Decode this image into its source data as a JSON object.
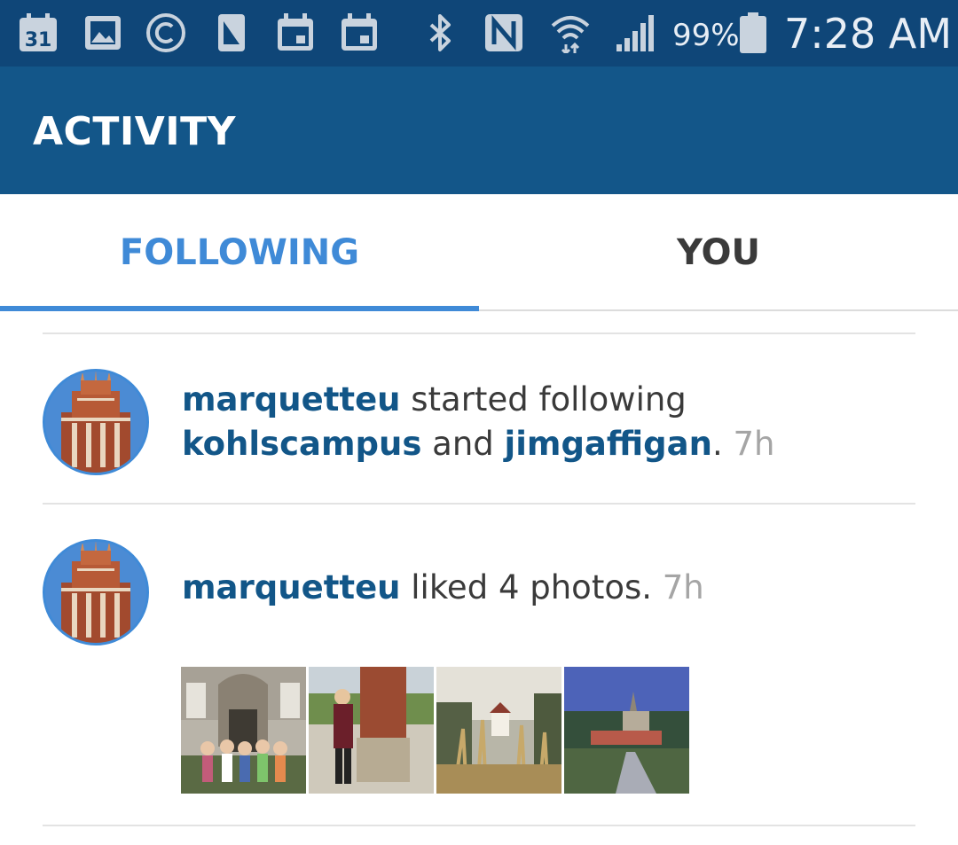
{
  "status_bar": {
    "icons": [
      "calendar-31-icon",
      "gallery-icon",
      "copyright-icon",
      "phone-icon",
      "calendar-event-icon",
      "calendar-event-icon",
      "bluetooth-icon",
      "nfc-icon",
      "wifi-icon",
      "signal-icon",
      "battery-icon"
    ],
    "calendar_day": "31",
    "battery_percent": "99%",
    "time": "7:28 AM"
  },
  "header": {
    "title": "ACTIVITY"
  },
  "tabs": [
    {
      "label": "FOLLOWING",
      "active": true
    },
    {
      "label": "YOU",
      "active": false
    }
  ],
  "feed": [
    {
      "user": "marquetteu",
      "action": " started following ",
      "target1": "kohlscampus",
      "connector": " and ",
      "target2": "jimgaffigan",
      "end": ". ",
      "time": "7h"
    },
    {
      "user": "marquetteu",
      "action": " liked 4 photos. ",
      "time": "7h",
      "photos": [
        "photo-group-at-doorway",
        "photo-student-at-sign",
        "photo-grass-closeup",
        "photo-campus-garden"
      ]
    }
  ],
  "colors": {
    "status_bar": "#0f4678",
    "action_bar": "#135689",
    "tab_active": "#3f8ad7",
    "username": "#125688",
    "timestamp": "#a5a5a5"
  }
}
